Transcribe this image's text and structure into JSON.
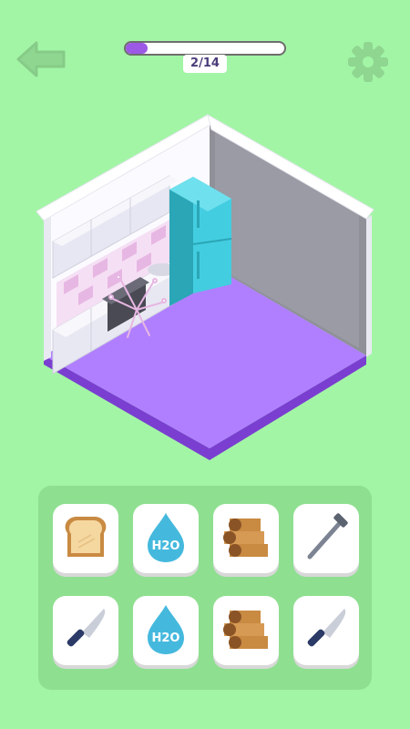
{
  "hud": {
    "level_text": "2/14",
    "progress": 0.14,
    "accent_color": "#9b59e6",
    "back_icon": "back-arrow-icon",
    "settings_icon": "gear-icon"
  },
  "items": [
    {
      "name": "toast",
      "icon": "toast-icon"
    },
    {
      "name": "water-drop-h2o",
      "icon": "water-drop-icon"
    },
    {
      "name": "wood-logs",
      "icon": "wood-icon"
    },
    {
      "name": "nail",
      "icon": "nail-icon"
    },
    {
      "name": "knife",
      "icon": "knife-icon"
    },
    {
      "name": "water-drop-h2o",
      "icon": "water-drop-icon"
    },
    {
      "name": "wood-logs",
      "icon": "wood-icon"
    },
    {
      "name": "knife",
      "icon": "knife-icon"
    }
  ],
  "h2o_label": "H2O"
}
